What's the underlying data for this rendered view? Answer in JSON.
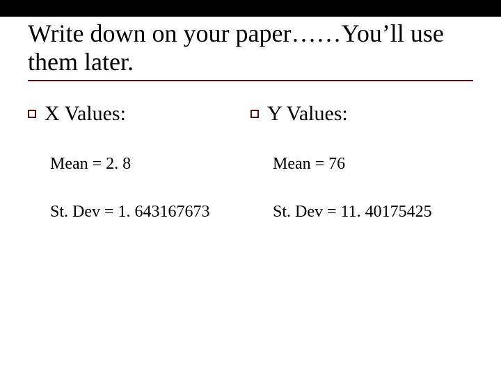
{
  "title": "Write down on your paper……You’ll use them later.",
  "columns": {
    "left": {
      "label": "X Values:",
      "mean": "Mean = 2. 8",
      "stdev": "St. Dev = 1. 643167673"
    },
    "right": {
      "label": "Y Values:",
      "mean": "Mean = 76",
      "stdev": "St. Dev = 11. 40175425"
    }
  }
}
